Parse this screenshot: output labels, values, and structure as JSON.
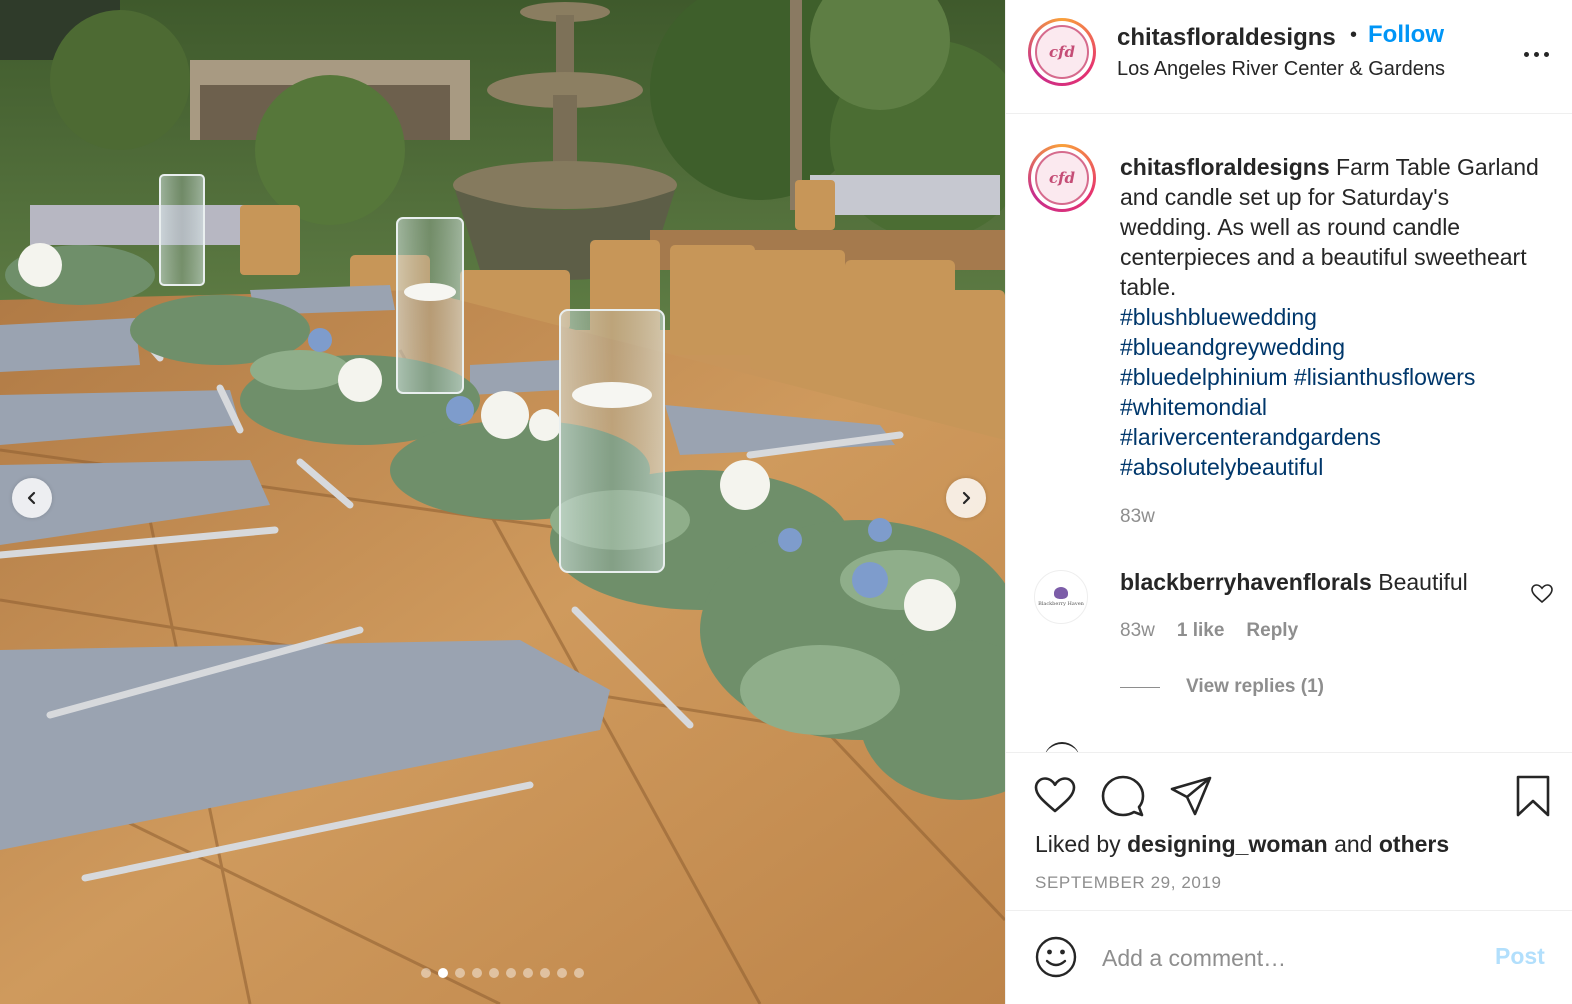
{
  "post": {
    "carousel": {
      "slide_count": 10,
      "active_index": 1
    }
  },
  "header": {
    "username": "chitasfloraldesigns",
    "separator": "•",
    "follow_label": "Follow",
    "location": "Los Angeles River Center & Gardens",
    "avatar_initials": "cfd"
  },
  "caption": {
    "username": "chitasfloraldesigns",
    "text": "Farm Table Garland and candle set up for Saturday's wedding. As well as round candle centerpieces and a beautiful sweetheart table.",
    "hashtags": [
      "#blushbluewedding",
      "#blueandgreywedding",
      "#bluedelphinium",
      "#lisianthusflowers",
      "#whitemondial",
      "#larivercenterandgardens",
      "#absolutelybeautiful"
    ],
    "time": "83w"
  },
  "comments": [
    {
      "username": "blackberryhavenflorals",
      "text": "Beautiful",
      "avatar_text": "Blackberry Haven",
      "time": "83w",
      "likes": "1 like",
      "reply_label": "Reply",
      "view_replies": "View replies (1)"
    }
  ],
  "likes": {
    "prefix": "Liked by",
    "user": "designing_woman",
    "joiner": "and",
    "others": "others"
  },
  "date": "SEPTEMBER 29, 2019",
  "comment_box": {
    "placeholder": "Add a comment…",
    "post_label": "Post"
  },
  "colors": {
    "link_blue": "#0095f6",
    "hashtag_blue": "#00376b",
    "muted_text": "#8e8e8e",
    "post_disabled": "#b2dffc"
  },
  "icons": [
    "chevron-left-icon",
    "chevron-right-icon",
    "more-icon",
    "heart-icon",
    "comment-icon",
    "share-icon",
    "bookmark-icon",
    "emoji-icon"
  ]
}
